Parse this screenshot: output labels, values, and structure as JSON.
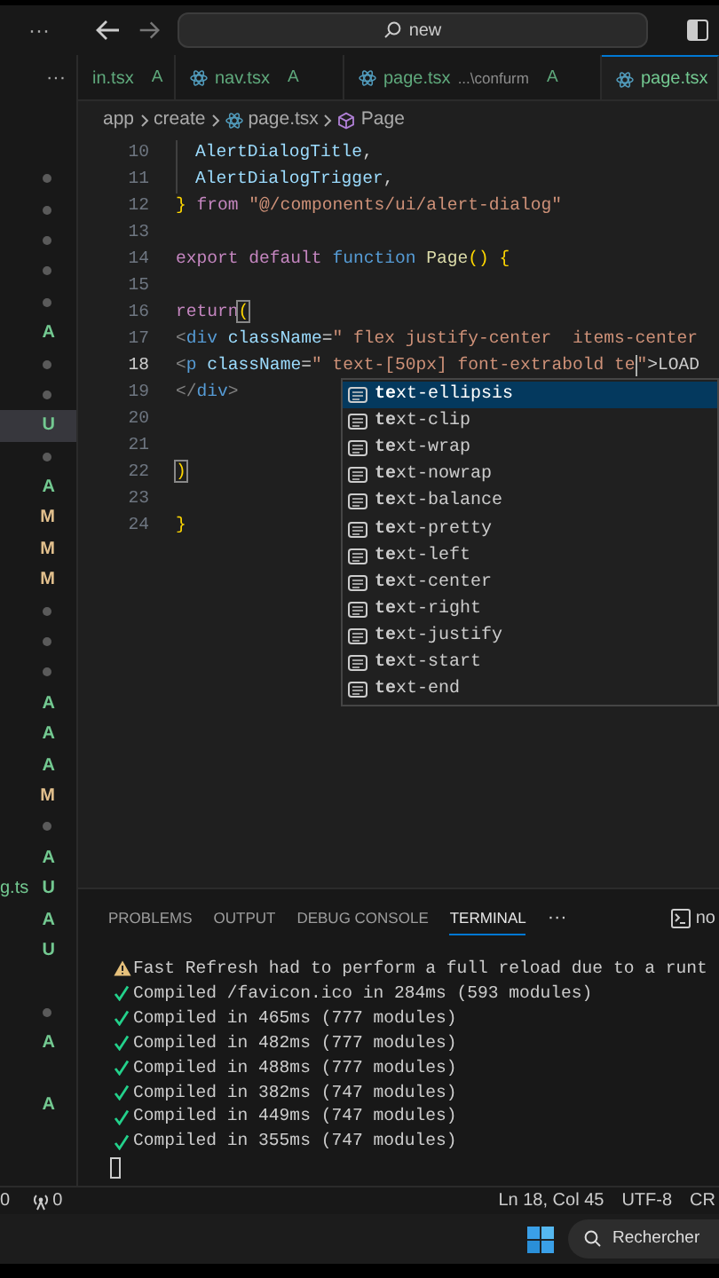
{
  "title_bar": {
    "menu": "···",
    "search": {
      "value": "new"
    }
  },
  "explorer": {
    "more": "···",
    "markers": [
      {
        "kind": "dot",
        "selected": false
      },
      {
        "kind": "dot",
        "selected": false
      },
      {
        "kind": "dot",
        "selected": false
      },
      {
        "kind": "dot",
        "selected": false
      },
      {
        "kind": "dot",
        "selected": false
      },
      {
        "kind": "letter",
        "text": "A",
        "color": "#73c991",
        "selected": false
      },
      {
        "kind": "dot",
        "selected": false
      },
      {
        "kind": "dot",
        "selected": false
      },
      {
        "kind": "letter",
        "text": "U",
        "color": "#73c991",
        "selected": true
      },
      {
        "kind": "dot",
        "selected": false
      },
      {
        "kind": "letter",
        "text": "A",
        "color": "#73c991",
        "selected": false
      },
      {
        "kind": "letter",
        "text": "M",
        "color": "#e2c08d",
        "selected": false
      },
      {
        "kind": "letter",
        "text": "M",
        "color": "#e2c08d",
        "selected": false
      },
      {
        "kind": "letter",
        "text": "M",
        "color": "#e2c08d",
        "selected": false
      },
      {
        "kind": "dot",
        "selected": false
      },
      {
        "kind": "dot",
        "selected": false
      },
      {
        "kind": "dot",
        "selected": false
      },
      {
        "kind": "letter",
        "text": "A",
        "color": "#73c991",
        "selected": false
      },
      {
        "kind": "letter",
        "text": "A",
        "color": "#73c991",
        "selected": false
      },
      {
        "kind": "letter",
        "text": "A",
        "color": "#73c991",
        "selected": false
      },
      {
        "kind": "letter",
        "text": "M",
        "color": "#e2c08d",
        "selected": false
      },
      {
        "kind": "dot",
        "selected": false
      },
      {
        "kind": "letter",
        "text": "A",
        "color": "#73c991",
        "selected": false
      },
      {
        "kind": "letter",
        "text": "U",
        "color": "#73c991",
        "file": "g.ts",
        "selected": false
      },
      {
        "kind": "letter",
        "text": "A",
        "color": "#73c991",
        "selected": false
      },
      {
        "kind": "letter",
        "text": "U",
        "color": "#73c991",
        "selected": false
      },
      {
        "kind": "gap"
      },
      {
        "kind": "dot",
        "selected": false
      },
      {
        "kind": "letter",
        "text": "A",
        "color": "#73c991",
        "selected": false
      },
      {
        "kind": "gap"
      },
      {
        "kind": "letter",
        "text": "A",
        "color": "#73c991",
        "selected": false
      }
    ]
  },
  "tabs": [
    {
      "label": "in.tsx",
      "badge": "A",
      "icon": false,
      "selected": false
    },
    {
      "label": "nav.tsx",
      "badge": "A",
      "icon": true,
      "selected": false
    },
    {
      "label": "page.tsx",
      "description": "...\\confurm",
      "badge": "A",
      "icon": true,
      "selected": false
    },
    {
      "label": "page.tsx",
      "icon": true,
      "selected": true
    }
  ],
  "breadcrumb": [
    {
      "label": "app",
      "kind": "folder"
    },
    {
      "label": "create",
      "kind": "folder"
    },
    {
      "label": "page.tsx",
      "kind": "file"
    },
    {
      "label": "Page",
      "kind": "symbol"
    }
  ],
  "code_lines": [
    {
      "number": "10",
      "current": false,
      "tokens": [
        {
          "kind": "indent-guide"
        },
        {
          "text": "AlertDialogTitle",
          "kind": "var"
        },
        {
          "text": ",",
          "kind": "plain"
        }
      ]
    },
    {
      "number": "11",
      "current": false,
      "tokens": [
        {
          "kind": "indent-guide"
        },
        {
          "text": "AlertDialogTrigger",
          "kind": "var"
        },
        {
          "text": ",",
          "kind": "plain"
        }
      ]
    },
    {
      "number": "12",
      "current": false,
      "tokens": [
        {
          "text": "}",
          "kind": "brace"
        },
        {
          "text": " from ",
          "kind": "keyword"
        },
        {
          "text": "\"@/components/ui/alert-dialog\"",
          "kind": "string"
        }
      ]
    },
    {
      "number": "13",
      "current": false
    },
    {
      "number": "14",
      "current": false,
      "tokens": [
        {
          "text": "export default ",
          "kind": "keyword"
        },
        {
          "text": "function ",
          "kind": "storage"
        },
        {
          "text": "Page",
          "kind": "func"
        },
        {
          "text": "() {",
          "kind": "brace"
        }
      ]
    },
    {
      "number": "15",
      "current": false
    },
    {
      "number": "16",
      "current": false,
      "tokens": [
        {
          "text": "return",
          "kind": "keyword"
        },
        {
          "text": "(",
          "kind": "match"
        }
      ]
    },
    {
      "number": "17",
      "current": false,
      "tokens": [
        {
          "text": "<",
          "kind": "tag-punct"
        },
        {
          "text": "div",
          "kind": "tag"
        },
        {
          "text": " className",
          "kind": "attr"
        },
        {
          "text": "=",
          "kind": "plain"
        },
        {
          "text": "\" flex justify-center  items-center",
          "kind": "string"
        }
      ]
    },
    {
      "number": "18",
      "current": true,
      "tokens": [
        {
          "text": "<",
          "kind": "tag-punct"
        },
        {
          "text": "p",
          "kind": "tag"
        },
        {
          "text": " className",
          "kind": "attr"
        },
        {
          "text": "=",
          "kind": "plain"
        },
        {
          "text": "\" text-[50px] font-extrabold te",
          "kind": "string"
        },
        {
          "kind": "cursor"
        },
        {
          "text": "\"",
          "kind": "string"
        },
        {
          "text": ">LOAD",
          "kind": "plain"
        }
      ]
    },
    {
      "number": "19",
      "current": false,
      "tokens": [
        {
          "text": "</",
          "kind": "tag-punct"
        },
        {
          "text": "div",
          "kind": "tag"
        },
        {
          "text": ">",
          "kind": "tag-punct"
        }
      ]
    },
    {
      "number": "20",
      "current": false
    },
    {
      "number": "21",
      "current": false
    },
    {
      "number": "22",
      "current": false,
      "tokens": [
        {
          "text": ")",
          "kind": "match"
        }
      ]
    },
    {
      "number": "23",
      "current": false
    },
    {
      "number": "24",
      "current": false,
      "tokens": [
        {
          "text": "}",
          "kind": "brace"
        }
      ]
    }
  ],
  "suggestions": [
    {
      "label": "**te**xt-ellipsis",
      "selected": true
    },
    {
      "label": "**te**xt-clip",
      "selected": false
    },
    {
      "label": "**te**xt-wrap",
      "selected": false
    },
    {
      "label": "**te**xt-nowrap",
      "selected": false
    },
    {
      "label": "**te**xt-balance",
      "selected": false
    },
    {
      "label": "**te**xt-pretty",
      "selected": false
    },
    {
      "label": "**te**xt-left",
      "selected": false
    },
    {
      "label": "**te**xt-center",
      "selected": false
    },
    {
      "label": "**te**xt-right",
      "selected": false
    },
    {
      "label": "**te**xt-justify",
      "selected": false
    },
    {
      "label": "**te**xt-start",
      "selected": false
    },
    {
      "label": "**te**xt-end",
      "selected": false
    }
  ],
  "panel": {
    "tabs": [
      {
        "label": "PROBLEMS",
        "selected": false
      },
      {
        "label": "OUTPUT",
        "selected": false
      },
      {
        "label": "DEBUG CONSOLE",
        "selected": false
      },
      {
        "label": "TERMINAL",
        "selected": true
      }
    ],
    "more": "···",
    "terminal_name": "no",
    "terminal_lines": [
      {
        "kind": "warning",
        "text": "Fast Refresh had to perform a full reload due to a runt"
      },
      {
        "kind": "success",
        "text": "Compiled /favicon.ico in 284ms (593 modules)"
      },
      {
        "kind": "success",
        "text": "Compiled in 465ms (777 modules)"
      },
      {
        "kind": "success",
        "text": "Compiled in 482ms (777 modules)"
      },
      {
        "kind": "success",
        "text": "Compiled in 488ms (777 modules)"
      },
      {
        "kind": "success",
        "text": "Compiled in 382ms (747 modules)"
      },
      {
        "kind": "success",
        "text": "Compiled in 449ms (747 modules)"
      },
      {
        "kind": "success",
        "text": "Compiled in 355ms (747 modules)"
      }
    ]
  },
  "status_bar": {
    "errors": "0",
    "ports": "0",
    "position": "Ln 18, Col 45",
    "encoding": "UTF-8",
    "line_ending": "CR"
  },
  "taskbar": {
    "search": "Rechercher"
  }
}
